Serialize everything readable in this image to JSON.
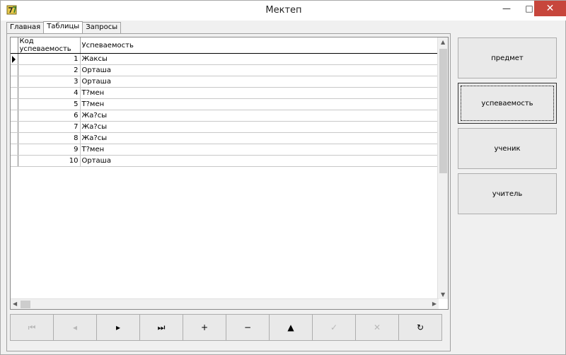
{
  "window": {
    "title": "Мектеп",
    "min_glyph": "—",
    "max_glyph": "□",
    "close_glyph": "✕"
  },
  "tabs": [
    {
      "label": "Главная",
      "active": false
    },
    {
      "label": "Таблицы",
      "active": true
    },
    {
      "label": "Запросы",
      "active": false
    }
  ],
  "grid": {
    "columns": [
      "Код успеваемость",
      "Успеваемость"
    ],
    "rows": [
      {
        "code": "1",
        "value": "Жаксы"
      },
      {
        "code": "2",
        "value": "Орташа"
      },
      {
        "code": "3",
        "value": "Орташа"
      },
      {
        "code": "4",
        "value": "Т?мен"
      },
      {
        "code": "5",
        "value": "Т?мен"
      },
      {
        "code": "6",
        "value": "Жа?сы"
      },
      {
        "code": "7",
        "value": "Жа?сы"
      },
      {
        "code": "8",
        "value": "Жа?сы"
      },
      {
        "code": "9",
        "value": "Т?мен"
      },
      {
        "code": "10",
        "value": "Орташа"
      }
    ]
  },
  "navigator": [
    {
      "name": "first-record-button",
      "glyph": "⏮",
      "enabled": false
    },
    {
      "name": "prior-record-button",
      "glyph": "◂",
      "enabled": false
    },
    {
      "name": "next-record-button",
      "glyph": "▸",
      "enabled": true
    },
    {
      "name": "last-record-button",
      "glyph": "⏭",
      "enabled": true
    },
    {
      "name": "insert-record-button",
      "glyph": "+",
      "enabled": true
    },
    {
      "name": "delete-record-button",
      "glyph": "−",
      "enabled": true
    },
    {
      "name": "edit-record-button",
      "glyph": "▲",
      "enabled": true
    },
    {
      "name": "post-record-button",
      "glyph": "✓",
      "enabled": false
    },
    {
      "name": "cancel-record-button",
      "glyph": "✕",
      "enabled": false
    },
    {
      "name": "refresh-button",
      "glyph": "↻",
      "enabled": true
    }
  ],
  "side_buttons": [
    {
      "label": "предмет"
    },
    {
      "label": "успеваемость"
    },
    {
      "label": "ученик"
    },
    {
      "label": "учитель"
    }
  ]
}
